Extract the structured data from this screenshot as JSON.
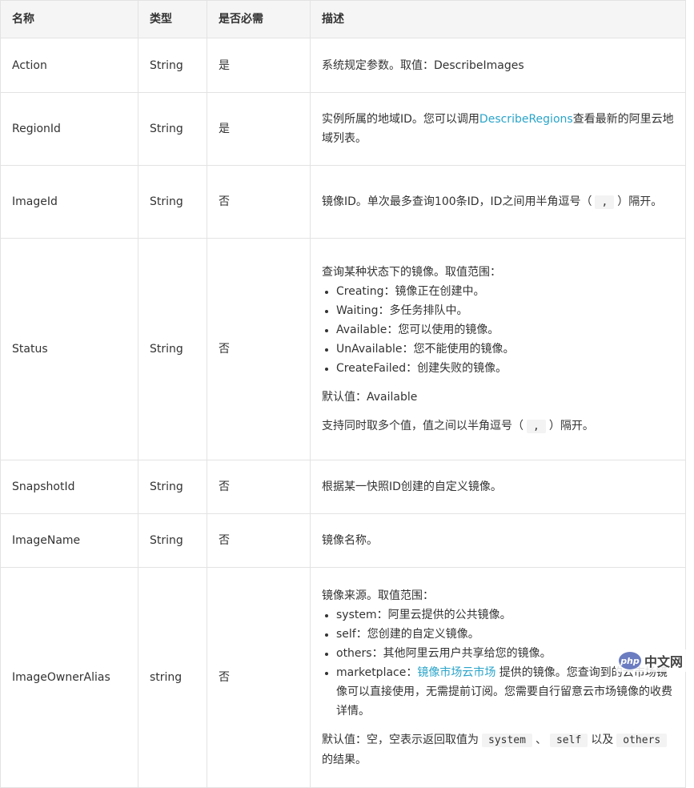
{
  "header": {
    "col_name": "名称",
    "col_type": "类型",
    "col_required": "是否必需",
    "col_desc": "描述"
  },
  "rows": {
    "action": {
      "name": "Action",
      "type": "String",
      "required": "是",
      "desc": "系统规定参数。取值：DescribeImages"
    },
    "region": {
      "name": "RegionId",
      "type": "String",
      "required": "是",
      "desc_pre": "实例所属的地域ID。您可以调用",
      "desc_link": "DescribeRegions",
      "desc_post": "查看最新的阿里云地域列表。"
    },
    "image": {
      "name": "ImageId",
      "type": "String",
      "required": "否",
      "desc_pre": "镜像ID。单次最多查询100条ID，ID之间用半角逗号（",
      "desc_code": ",",
      "desc_post": "）隔开。"
    },
    "status": {
      "name": "Status",
      "type": "String",
      "required": "否",
      "intro": "查询某种状态下的镜像。取值范围：",
      "items": [
        "Creating：镜像正在创建中。",
        "Waiting：多任务排队中。",
        "Available：您可以使用的镜像。",
        "UnAvailable：您不能使用的镜像。",
        "CreateFailed：创建失败的镜像。"
      ],
      "default": "默认值：Available",
      "multi_pre": "支持同时取多个值，值之间以半角逗号（",
      "multi_code": ",",
      "multi_post": "）隔开。"
    },
    "snapshot": {
      "name": "SnapshotId",
      "type": "String",
      "required": "否",
      "desc": "根据某一快照ID创建的自定义镜像。"
    },
    "imagename": {
      "name": "ImageName",
      "type": "String",
      "required": "否",
      "desc": "镜像名称。"
    },
    "alias": {
      "name": "ImageOwnerAlias",
      "type": "string",
      "required": "否",
      "intro": "镜像来源。取值范围：",
      "items": [
        "system：阿里云提供的公共镜像。",
        "self：您创建的自定义镜像。",
        "others：其他阿里云用户共享给您的镜像。"
      ],
      "market_pre": "marketplace：",
      "market_link": "镜像市场云市场",
      "market_post": " 提供的镜像。您查询到的云市场镜像可以直接使用，无需提前订阅。您需要自行留意云市场镜像的收费详情。",
      "default_pre": "默认值：空，空表示返回取值为",
      "code1": "system",
      "sep": "、",
      "code2": "self",
      "mid": "以及",
      "code3": "others",
      "default_post": "的结果。"
    }
  },
  "watermark": {
    "logo": "php",
    "text": "中文网"
  }
}
